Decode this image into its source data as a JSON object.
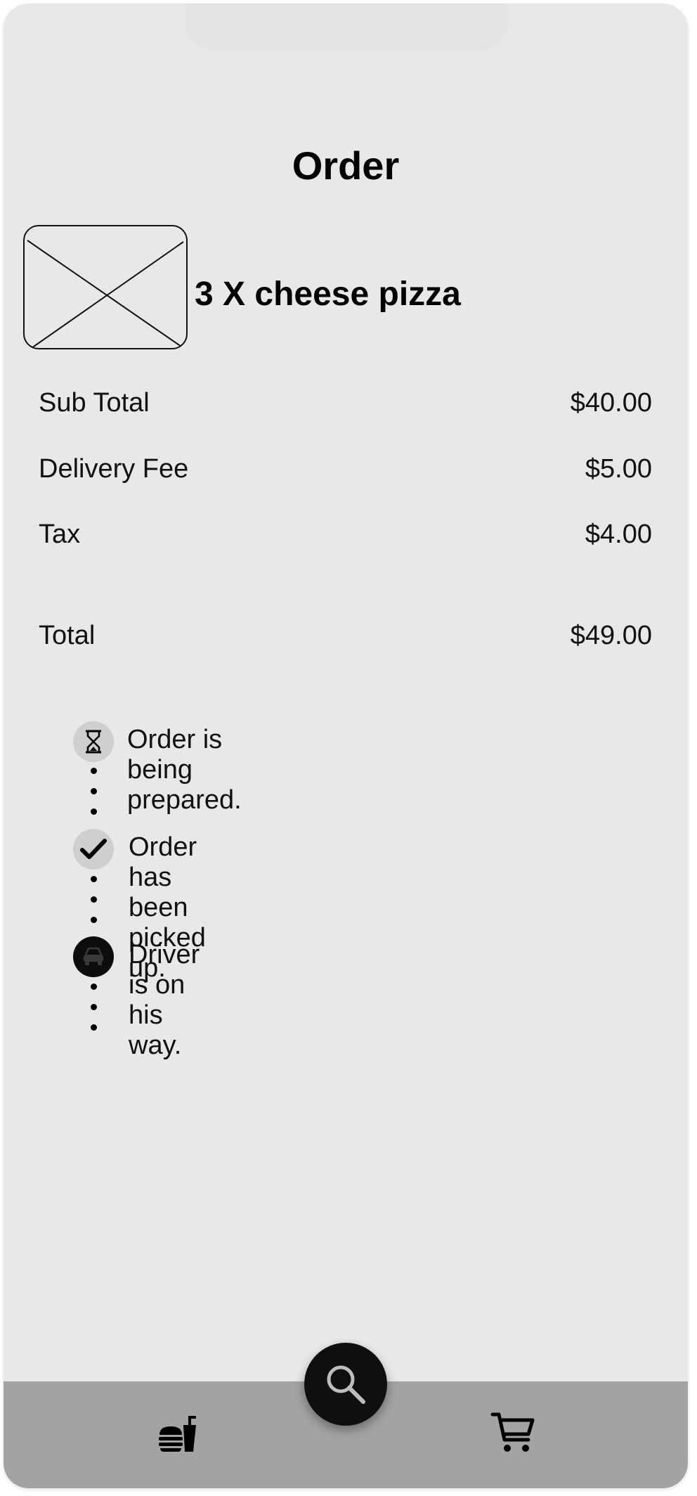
{
  "page": {
    "title": "Order"
  },
  "order": {
    "item_title": "3 X cheese pizza",
    "item_image_icon": "image-placeholder-icon",
    "summary": [
      {
        "label": "Sub Total",
        "value": "$40.00"
      },
      {
        "label": "Delivery Fee",
        "value": "$5.00"
      },
      {
        "label": "Tax",
        "value": "$4.00"
      },
      {
        "label": "Total",
        "value": "$49.00"
      }
    ]
  },
  "status": [
    {
      "text": "Order is being prepared.",
      "icon": "hourglass-icon",
      "state": "light"
    },
    {
      "text": "Order has been picked up.",
      "icon": "check-icon",
      "state": "light"
    },
    {
      "text": "Driver is on his way.",
      "icon": "car-icon",
      "state": "dark"
    }
  ],
  "bottom_nav": {
    "left_icon": "food-icon",
    "center_icon": "search-icon",
    "right_icon": "cart-icon"
  },
  "colors": {
    "background": "#e8e8e8",
    "bottom_bar": "#a3a3a3",
    "fab": "#0f0f0f",
    "status_light": "#cfcfcf",
    "status_dark": "#0d0d0d"
  }
}
